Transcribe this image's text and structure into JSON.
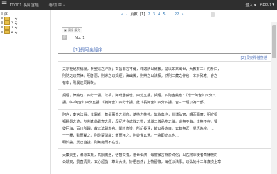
{
  "topbar": {
    "doc_id": "T0001",
    "doc_name": "長阿含經",
    "separator": "|",
    "nav_label": "卷/篇章 ⋯",
    "login": "登入 ▾",
    "about": "About ▾"
  },
  "sidebar": {
    "items": [
      {
        "toggle": "⊟",
        "label": "序"
      },
      {
        "toggle": "⊞",
        "label": "1 分"
      },
      {
        "toggle": "⊞",
        "label": "2 分"
      },
      {
        "toggle": "⊞",
        "label": "3 分"
      },
      {
        "toggle": "⊞",
        "label": "4 分"
      }
    ]
  },
  "pagination": {
    "first": "«",
    "prev": "‹",
    "page_label": "頁數: [1]",
    "pages": [
      "2",
      "3",
      "4",
      "5",
      "…",
      "22"
    ],
    "next": "›"
  },
  "content": {
    "tool_button": "▣ 資訊 原文",
    "tag": "序",
    "number": "No. 1",
    "title": "[1]長阿含經序",
    "ref_link": "[2]長安釋僧肇述",
    "paragraphs": [
      [
        "夫宗極絕於稱謂，賢聖以之沖默；玄旨非言不傳，釋迦所以致教。是以如來出世，大教有三：約身口，",
        "則防之以禁律；明善惡，則導之以契經；演幽微，則辨之以法相。然則三藏之作也，本於殊應，會之",
        "有本，則異途同歸矣。"
      ],
      [
        "契經，律藏也，四分十誦。法相，阿毗曇藏也，四分五誦。契經，四阿含藏也：《增一阿含》四分八",
        "誦，《中阿含》四分五誦，《雜阿含》四分十誦，此《長阿含》四分四誦，合三十經以為一部。"
      ],
      [
        "阿含，秦言法歸。法歸者，蓋是萬善之淵府，總持之林苑。其為典也，淵博弘富，韞而彌廣；明宣禍",
        "福賢愚之迹，剖判真偽異齊之原，歷記古今成敗之數，墟域二儀品物之倫。道無不由，法無不在。譬",
        "彼巨海，百川所歸，故以法歸為名。開析修塗，所記長遠，故以長為目。玄籍無涯，覺悟為宗。...",
        "十一種，勤而闡之，則發蒙開識；散而用之，則妙覺玄通。一詠即此本也...",
        "明於論，業己自說，則無施而不在也。"
      ],
      [
        "大秦天王，滌除玄覽，高韻獨邁，恬智交養，道世俱濟，每懼微言翳於殊俗；以右將軍使者司隸校尉",
        "公姚爽，質直清柔，玄心超詣，尊尚大法，妙悟自然；上特留懷，每任以法事。以弘始十二年歲次上章"
      ]
    ]
  }
}
